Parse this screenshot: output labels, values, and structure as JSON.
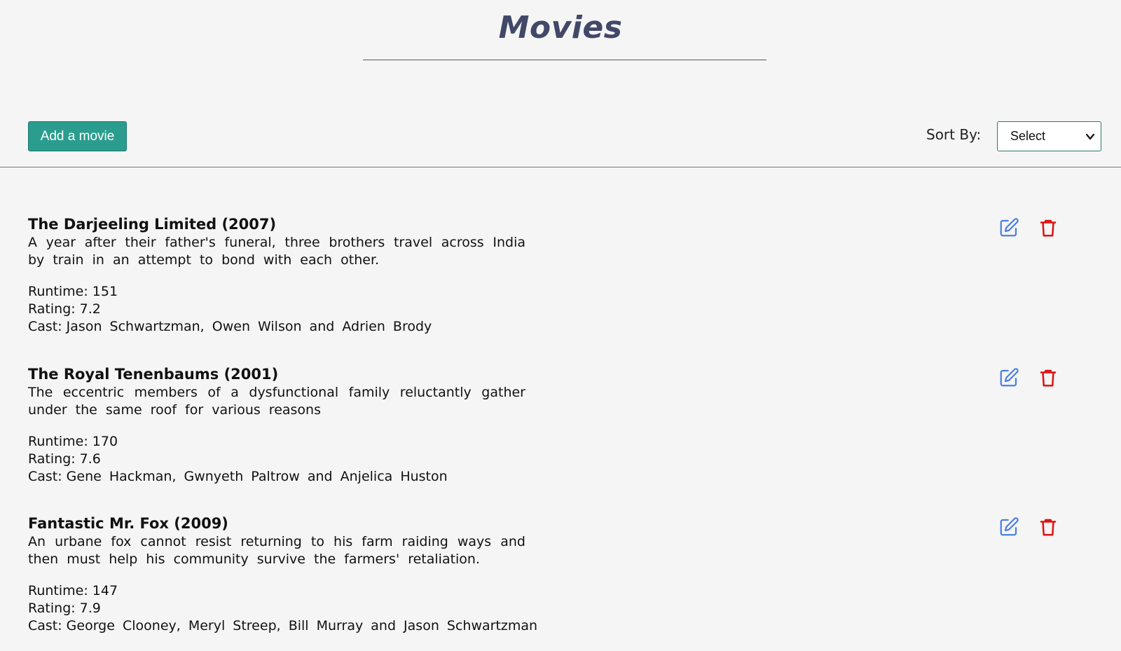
{
  "header": {
    "title": "Movies"
  },
  "toolbar": {
    "add_label": "Add a movie",
    "sort_label": "Sort By:",
    "sort_value": "Select"
  },
  "labels": {
    "runtime": "Runtime:",
    "rating": "Rating:",
    "cast": "Cast:"
  },
  "colors": {
    "accent": "#2a9d8f",
    "title": "#414868",
    "edit_icon": "#4a7fe0",
    "delete_icon": "#e01010"
  },
  "movies": [
    {
      "title": "The Darjeeling Limited (2007)",
      "description": "A year after their father's funeral, three brothers travel across India by train in an attempt to bond with each other.",
      "runtime": "151",
      "rating": "7.2",
      "cast": "Jason Schwartzman, Owen Wilson and Adrien Brody"
    },
    {
      "title": "The Royal Tenenbaums (2001)",
      "description": "The eccentric members of a dysfunctional family reluctantly gather under the same roof for various reasons",
      "runtime": "170",
      "rating": "7.6",
      "cast": "Gene Hackman, Gwnyeth Paltrow and Anjelica Huston"
    },
    {
      "title": "Fantastic Mr. Fox (2009)",
      "description": "An urbane fox cannot resist returning to his farm raiding ways and then must help his community survive the farmers' retaliation.",
      "runtime": "147",
      "rating": "7.9",
      "cast": "George Clooney, Meryl Streep, Bill Murray and Jason Schwartzman"
    }
  ]
}
